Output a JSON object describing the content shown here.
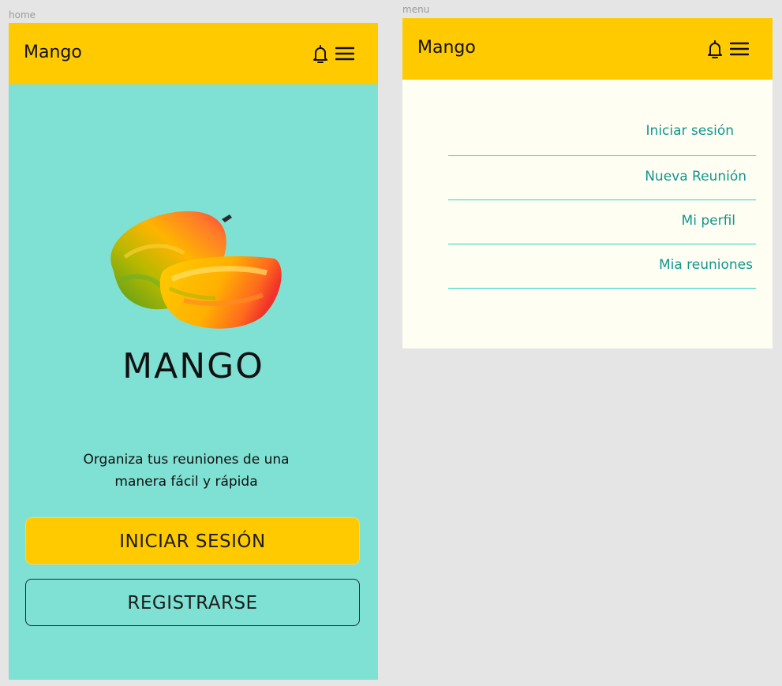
{
  "frames": {
    "home_label": "home",
    "menu_label": "menu"
  },
  "home": {
    "brand": "Mango",
    "logo_text": "MANGO",
    "tagline": "Organiza tus reuniones de una manera fácil y rápida",
    "login_button": "INICIAR SESIÓN",
    "register_button": "REGISTRARSE"
  },
  "menu": {
    "brand": "Mango",
    "items": [
      {
        "label": "Iniciar sesión"
      },
      {
        "label": "Nueva Reunión"
      },
      {
        "label": "Mi perfil"
      },
      {
        "label": "Mia reuniones"
      }
    ]
  },
  "icons": {
    "notification": "bell-icon",
    "menu": "hamburger-icon",
    "illustration": "mango-illustration"
  },
  "colors": {
    "accent": "#ffcb00",
    "home_background": "#7fe0d4",
    "menu_background": "#fefef3",
    "menu_text": "#12968e",
    "divider": "#2ad2c2"
  }
}
